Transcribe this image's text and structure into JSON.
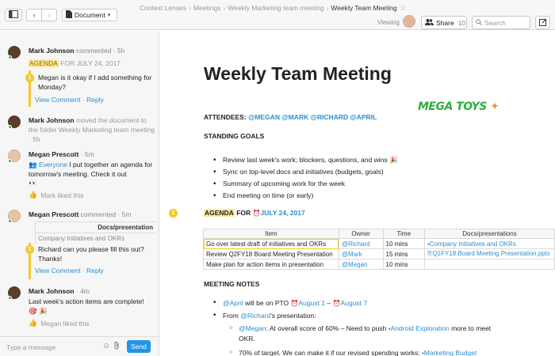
{
  "toolbar": {
    "doc_menu_label": "Document",
    "breadcrumbs": [
      "Context Lenses",
      "Meetings",
      "Weekly Marketing team meeting"
    ],
    "current": "Weekly Team Meeting",
    "viewing_label": "Viewing",
    "share_label": "Share",
    "share_count": "10",
    "search_placeholder": "Search"
  },
  "sidebar": {
    "items": [
      {
        "author": "Mark Johnson",
        "verb": "commented",
        "time": "· 5h",
        "highlight": "AGENDA",
        "highlight_rest": "FOR JULY 24, 2017",
        "badge": "1",
        "quote": "Megan is it okay if I add something for Monday?",
        "view_comment": "View Comment",
        "reply": "Reply"
      },
      {
        "author": "Mark Johnson",
        "text": "moved the document to the folder Weekly Marketing team meeting · 5h"
      },
      {
        "author": "Megan Prescott",
        "time": "· 5m",
        "mention": "Everyone",
        "text": "I put together an agenda for tomorrow's meeting. Check it out",
        "emoji": "👀",
        "liked": "Mark liked this"
      },
      {
        "author": "Megan Prescott",
        "verb": "commented",
        "time": "· 5m",
        "docs_header": "Docs/presentation",
        "docs_row": "Company Initiatives and OKRs",
        "badge": "1",
        "quote": "Richard can you please fill this out? Thanks!",
        "view_comment": "View Comment",
        "reply": "Reply"
      },
      {
        "author": "Mark Johnson",
        "time": "· 4m",
        "text": "Last week's action items are complete!",
        "emoji": "🎯 🎉",
        "liked": "Megan liked this"
      }
    ],
    "message_placeholder": "Type a message",
    "send_label": "Send"
  },
  "document": {
    "title": "Weekly Team Meeting",
    "logo_text": "MEGA TOYS",
    "attendees_label": "ATTENDEES:",
    "attendees": [
      "@MEGAN",
      "@MARK",
      "@RICHARD",
      "@APRIL"
    ],
    "standing_goals_heading": "STANDING GOALS",
    "goals": [
      "Review last week's work; blockers, questions, and wins 🎉",
      "Sync on top-level docs and initiatives (budgets, goals)",
      "Summary of upcoming work for the week",
      "End meeting on time (or early)"
    ],
    "agenda_badge": "1",
    "agenda_word": "AGENDA",
    "agenda_for": "FOR",
    "agenda_date": "JULY 24, 2017",
    "table": {
      "headers": [
        "Item",
        "Owner",
        "Time",
        "Docs/presentations"
      ],
      "rows": [
        [
          "Go over latest draft of initiatives and OKRs",
          "@Richard",
          "10 mins",
          "Company Initiatives and OKRs"
        ],
        [
          "Review Q2FY18 Board Meeting Presentation",
          "@Mark",
          "15 mins",
          "Q1FY18 Board Meeting Presentation.pptx"
        ],
        [
          "Make plan for action items in presentation",
          "@Megan",
          "10 mins",
          ""
        ]
      ]
    },
    "notes_heading": "MEETING NOTES",
    "notes": {
      "april_mention": "@April",
      "april_text": "will be on PTO",
      "date_from": "August 1",
      "dash": "–",
      "date_to": "August 7",
      "from_label": "From",
      "richard_mention": "@Richard",
      "presentation_text": "'s presentation:",
      "sub1_mention": "@Megan",
      "sub1_text": ": At overall score of 60% – Need to push",
      "sub1_link": "Android Exploration",
      "sub1_tail": "more to meet OKR.",
      "sub2_text": "70% of target. We can make it if our revised spending works:",
      "sub2_link": "Marketing Budget"
    }
  }
}
